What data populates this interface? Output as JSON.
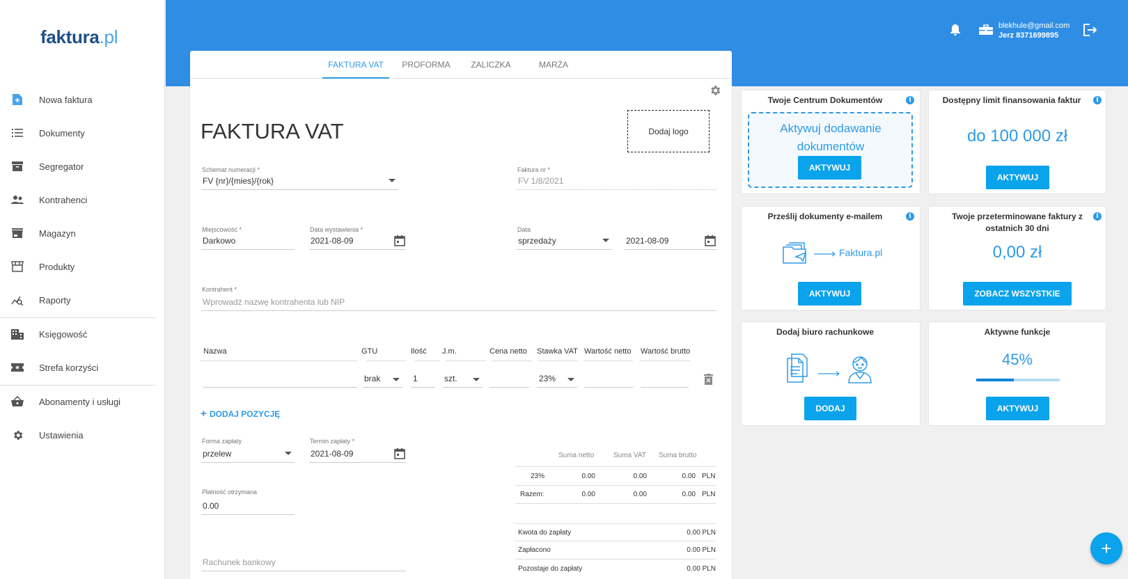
{
  "logo": {
    "main": "faktura",
    "suffix": ".pl"
  },
  "sidebar": {
    "items": [
      {
        "label": "Nowa faktura",
        "icon": "new-document-icon"
      },
      {
        "label": "Dokumenty",
        "icon": "list-icon"
      },
      {
        "label": "Segregator",
        "icon": "archive-icon"
      },
      {
        "label": "Kontrahenci",
        "icon": "people-icon"
      },
      {
        "label": "Magazyn",
        "icon": "store-icon"
      },
      {
        "label": "Produkty",
        "icon": "shop-icon"
      },
      {
        "label": "Raporty",
        "icon": "chart-search-icon"
      },
      {
        "label": "Księgowość",
        "icon": "building-icon"
      },
      {
        "label": "Strefa korzyści",
        "icon": "ticket-icon"
      },
      {
        "label": "Abonamenty i usługi",
        "icon": "basket-icon"
      },
      {
        "label": "Ustawienia",
        "icon": "gear-icon"
      }
    ]
  },
  "header": {
    "email": "blekhule@gmail.com",
    "user": "Jerz 8371699895"
  },
  "invoice": {
    "tabs": [
      "FAKTURA VAT",
      "PROFORMA",
      "ZALICZKA",
      "MARŻA"
    ],
    "title": "FAKTURA VAT",
    "logo_button": "Dodaj logo",
    "numbering_label": "Schemat numeracji *",
    "numbering_value": "FV {nr}/{mies}/{rok}",
    "invoice_no_label": "Faktura nr *",
    "invoice_no_value": "FV 1/8/2021",
    "city_label": "Miejscowość *",
    "city_value": "Darkowo",
    "issue_date_label": "Data wystawienia *",
    "issue_date_value": "2021-08-09",
    "date_label": "Data",
    "date_type_value": "sprzedaży",
    "date_value": "2021-08-09",
    "contractor_label": "Kontrahent *",
    "contractor_placeholder": "Wprowadź nazwę kontrahenta lub NIP",
    "items_headers": [
      "Nazwa",
      "GTU",
      "Ilość",
      "J.m.",
      "Cena netto",
      "Stawka VAT",
      "Wartość netto",
      "Wartość brutto"
    ],
    "item_row": {
      "gtu": "brak",
      "qty": "1",
      "unit": "szt.",
      "vat": "23%"
    },
    "add_position": "DODAJ POZYCJĘ",
    "payment_label": "Forma zapłaty",
    "payment_value": "przelew",
    "due_label": "Termin zapłaty *",
    "due_value": "2021-08-09",
    "received_label": "Płatność otrzymana",
    "received_value": "0.00",
    "bank_placeholder": "Rachunek bankowy",
    "summary": {
      "headers": [
        "Suma netto",
        "Suma VAT",
        "Suma brutto"
      ],
      "rows": [
        {
          "label": "23%",
          "netto": "0.00",
          "vat": "0.00",
          "brutto": "0.00",
          "cur": "PLN"
        },
        {
          "label": "Razem:",
          "netto": "0.00",
          "vat": "0.00",
          "brutto": "0.00",
          "cur": "PLN"
        }
      ],
      "totals": [
        {
          "label": "Kwota do zapłaty",
          "value": "0.00 PLN"
        },
        {
          "label": "Zapłacono",
          "value": "0.00 PLN"
        },
        {
          "label": "Pozostaje do zapłaty",
          "value": "0.00 PLN"
        }
      ]
    }
  },
  "cards": {
    "doc_center": {
      "title": "Twoje Centrum Dokumentów",
      "text": "Aktywuj dodawanie dokumentów",
      "button": "AKTYWUJ"
    },
    "limit": {
      "title": "Dostępny limit finansowania faktur",
      "value": "do 100 000 zł",
      "button": "AKTYWUJ"
    },
    "email": {
      "title": "Prześlij dokumenty e-mailem",
      "target": "Faktura.pl",
      "button": "AKTYWUJ"
    },
    "overdue": {
      "title": "Twoje przeterminowane faktury z ostatnich 30 dni",
      "value": "0,00 zł",
      "button": "ZOBACZ WSZYSTKIE"
    },
    "accounting": {
      "title": "Dodaj biuro rachunkowe",
      "button": "DODAJ"
    },
    "features": {
      "title": "Aktywne funkcje",
      "percent": "45%",
      "progress": 0.45,
      "button": "AKTYWUJ"
    }
  },
  "colors": {
    "primary": "#2f8de4",
    "accent": "#0aa3ec",
    "brand_dark": "#1d4f8a"
  }
}
